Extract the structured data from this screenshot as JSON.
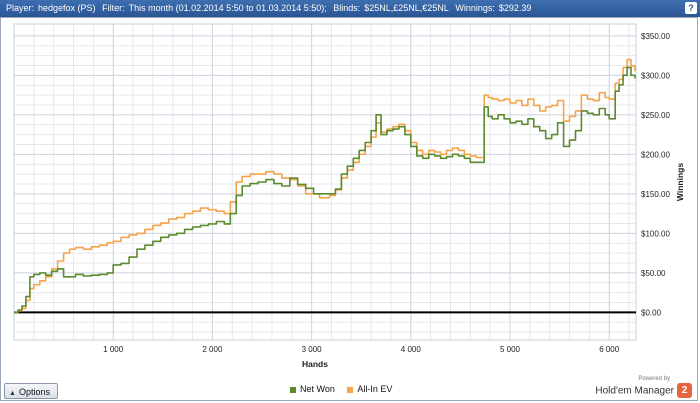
{
  "title_bar": {
    "player_label": "Player:",
    "player_value": "hedgefox (PS)",
    "filter_label": "Filter:",
    "filter_value": "This month (01.02.2014 5:50 to 01.03.2014 5:50);",
    "blinds_label": "Blinds:",
    "blinds_value": "$25NL,£25NL,€25NL",
    "winnings_label": "Winnings:",
    "winnings_value": "$292.39",
    "help_icon": "question-icon"
  },
  "options_button": {
    "label": "Options",
    "icon": "triangle-up-icon"
  },
  "legend": [
    {
      "label": "Net Won",
      "color": "#5c8a2e"
    },
    {
      "label": "All-In EV",
      "color": "#f5a44c"
    }
  ],
  "branding": {
    "powered_by": "Powered by",
    "name": "Hold'em Manager",
    "logo_text": "2"
  },
  "chart_data": {
    "type": "line",
    "xlabel": "Hands",
    "ylabel": "Winnings",
    "xlim": [
      0,
      6270
    ],
    "ylim": [
      -35,
      365
    ],
    "x_ticks": [
      1000,
      2000,
      3000,
      4000,
      5000,
      6000
    ],
    "x_tick_labels": [
      "1 000",
      "2 000",
      "3 000",
      "4 000",
      "5 000",
      "6 000"
    ],
    "y_ticks": [
      0,
      50,
      100,
      150,
      200,
      250,
      300,
      350
    ],
    "y_tick_labels": [
      "$0.00",
      "$50.00",
      "$100.00",
      "$150.00",
      "$200.00",
      "$250.00",
      "$300.00",
      "$350.00"
    ],
    "grid": true,
    "zero_line": true,
    "series": [
      {
        "name": "Net Won",
        "color": "#5c8a2e",
        "x": [
          0,
          40,
          80,
          120,
          160,
          200,
          260,
          320,
          380,
          440,
          500,
          560,
          620,
          700,
          780,
          860,
          940,
          1000,
          1080,
          1160,
          1240,
          1320,
          1400,
          1480,
          1560,
          1640,
          1720,
          1800,
          1880,
          1960,
          2040,
          2120,
          2180,
          2240,
          2300,
          2380,
          2460,
          2540,
          2620,
          2700,
          2780,
          2860,
          2940,
          3020,
          3080,
          3120,
          3180,
          3240,
          3300,
          3360,
          3420,
          3480,
          3540,
          3600,
          3650,
          3700,
          3760,
          3820,
          3880,
          3940,
          4000,
          4060,
          4120,
          4180,
          4240,
          4300,
          4360,
          4420,
          4480,
          4540,
          4600,
          4660,
          4700,
          4740,
          4780,
          4820,
          4880,
          4940,
          5000,
          5060,
          5120,
          5180,
          5240,
          5300,
          5360,
          5420,
          5480,
          5540,
          5600,
          5660,
          5720,
          5780,
          5840,
          5900,
          5960,
          6000,
          6060,
          6100,
          6140,
          6180,
          6220,
          6260
        ],
        "y": [
          0,
          3,
          8,
          20,
          45,
          48,
          50,
          47,
          52,
          55,
          45,
          45,
          48,
          46,
          47,
          48,
          50,
          60,
          62,
          70,
          80,
          85,
          90,
          95,
          98,
          100,
          105,
          108,
          110,
          112,
          115,
          112,
          125,
          148,
          160,
          163,
          165,
          168,
          163,
          160,
          170,
          162,
          157,
          150,
          150,
          150,
          150,
          156,
          175,
          185,
          195,
          205,
          215,
          230,
          250,
          225,
          230,
          232,
          235,
          225,
          210,
          198,
          195,
          200,
          198,
          195,
          197,
          200,
          198,
          195,
          190,
          190,
          190,
          260,
          248,
          245,
          250,
          245,
          240,
          242,
          238,
          245,
          235,
          230,
          220,
          225,
          240,
          210,
          218,
          230,
          255,
          252,
          250,
          258,
          250,
          245,
          280,
          288,
          300,
          310,
          300,
          296
        ]
      },
      {
        "name": "All-In EV",
        "color": "#f5a44c",
        "x": [
          0,
          40,
          80,
          120,
          160,
          200,
          260,
          320,
          380,
          440,
          500,
          560,
          620,
          700,
          780,
          860,
          940,
          1000,
          1080,
          1160,
          1240,
          1320,
          1400,
          1480,
          1560,
          1640,
          1720,
          1800,
          1880,
          1960,
          2040,
          2120,
          2180,
          2240,
          2300,
          2380,
          2460,
          2540,
          2620,
          2700,
          2780,
          2860,
          2940,
          3020,
          3080,
          3120,
          3180,
          3240,
          3300,
          3360,
          3420,
          3480,
          3540,
          3600,
          3650,
          3700,
          3760,
          3820,
          3880,
          3940,
          4000,
          4060,
          4120,
          4180,
          4240,
          4300,
          4360,
          4420,
          4480,
          4540,
          4600,
          4660,
          4700,
          4740,
          4780,
          4820,
          4880,
          4940,
          5000,
          5060,
          5120,
          5180,
          5240,
          5300,
          5360,
          5420,
          5480,
          5540,
          5600,
          5660,
          5720,
          5780,
          5840,
          5900,
          5960,
          6000,
          6060,
          6100,
          6140,
          6180,
          6220,
          6260
        ],
        "y": [
          0,
          2,
          5,
          15,
          30,
          35,
          40,
          45,
          55,
          65,
          75,
          80,
          82,
          80,
          83,
          85,
          88,
          90,
          95,
          98,
          100,
          105,
          110,
          113,
          118,
          120,
          125,
          128,
          132,
          130,
          128,
          125,
          140,
          165,
          172,
          175,
          175,
          178,
          175,
          170,
          168,
          160,
          150,
          150,
          145,
          145,
          148,
          155,
          170,
          180,
          190,
          200,
          210,
          222,
          240,
          228,
          232,
          235,
          238,
          230,
          215,
          205,
          200,
          205,
          203,
          200,
          205,
          208,
          205,
          200,
          198,
          196,
          196,
          275,
          272,
          270,
          268,
          270,
          265,
          268,
          262,
          270,
          262,
          255,
          260,
          262,
          268,
          242,
          248,
          255,
          275,
          270,
          268,
          278,
          272,
          270,
          290,
          295,
          310,
          320,
          312,
          305
        ]
      }
    ]
  }
}
